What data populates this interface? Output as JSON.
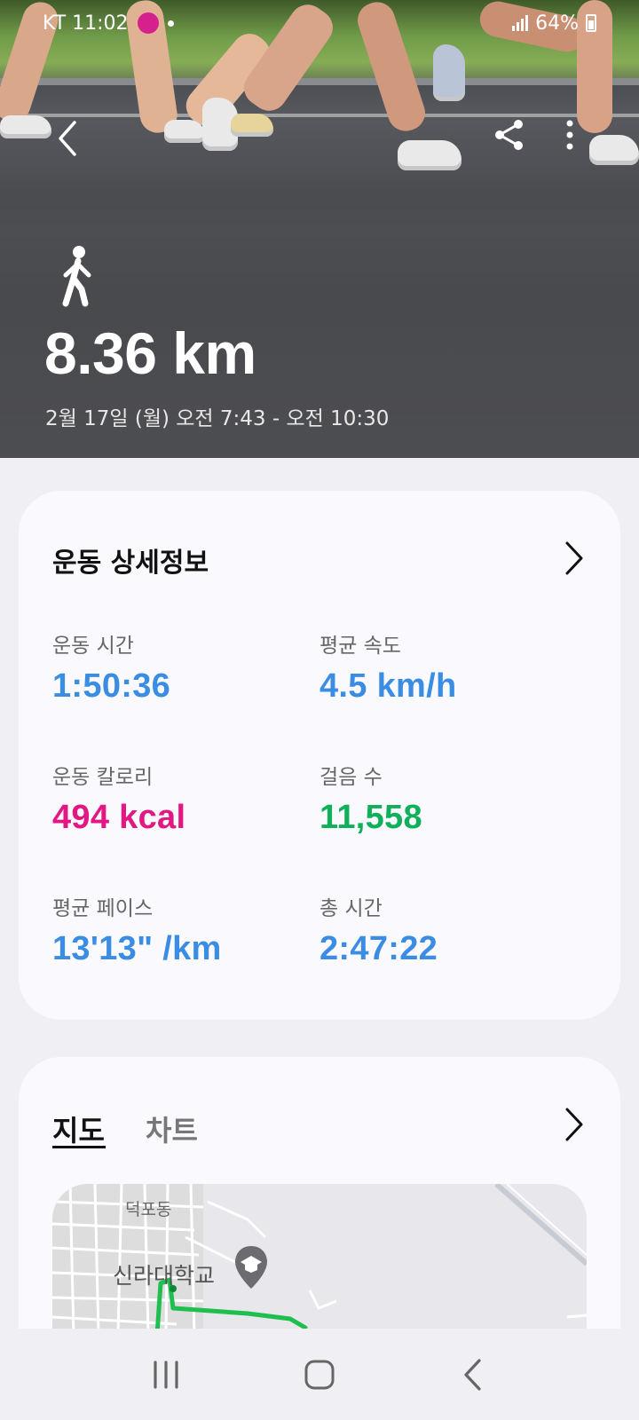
{
  "status_bar": {
    "carrier_time": "KT 11:02",
    "battery": "64%"
  },
  "hero": {
    "distance": "8.36 km",
    "date_range": "2월 17일 (월) 오전 7:43 - 오전 10:30"
  },
  "details": {
    "title": "운동 상세정보",
    "metrics": [
      {
        "label": "운동 시간",
        "value": "1:50:36",
        "color": "#3b8de4"
      },
      {
        "label": "평균 속도",
        "value": "4.5 km/h",
        "color": "#3b8de4"
      },
      {
        "label": "운동 칼로리",
        "value": "494 kcal",
        "color": "#e21784"
      },
      {
        "label": "걸음 수",
        "value": "11,558",
        "color": "#10b05a"
      },
      {
        "label": "평균 페이스",
        "value": "13'13\" /km",
        "color": "#3b8de4"
      },
      {
        "label": "총 시간",
        "value": "2:47:22",
        "color": "#3b8de4"
      }
    ]
  },
  "map_card": {
    "tabs": [
      "지도",
      "차트"
    ],
    "active_tab": "지도",
    "map_labels": {
      "district": "덕포동",
      "university": "신라대학교"
    },
    "route_color": "#1fbf4f"
  },
  "icons": {
    "back": "chevron-left-icon",
    "share": "share-icon",
    "more": "more-vertical-icon",
    "activity": "walking-person-icon"
  }
}
